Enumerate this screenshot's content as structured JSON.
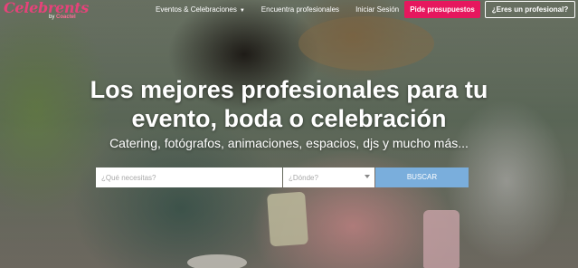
{
  "brand": {
    "name": "Celebrents",
    "by_prefix": "by ",
    "by_name": "Coactel"
  },
  "nav": {
    "items": [
      {
        "label": "Eventos & Celebraciones"
      },
      {
        "label": "Encuentra profesionales"
      },
      {
        "label": "Iniciar Sesión"
      }
    ],
    "cta_primary": "Pide presupuestos",
    "cta_secondary": "¿Eres un profesional?"
  },
  "hero": {
    "headline_line1": "Los mejores profesionales para tu",
    "headline_line2": "evento, boda o celebración",
    "subline": "Catering, fotógrafos, animaciones, espacios, djs y mucho más..."
  },
  "search": {
    "what_placeholder": "¿Qué necesitas?",
    "what_value": "",
    "where_placeholder": "¿Dónde?",
    "where_value": "",
    "button_label": "BUSCAR"
  },
  "colors": {
    "brand_pink": "#e6175e",
    "search_button": "#7aaedc"
  }
}
